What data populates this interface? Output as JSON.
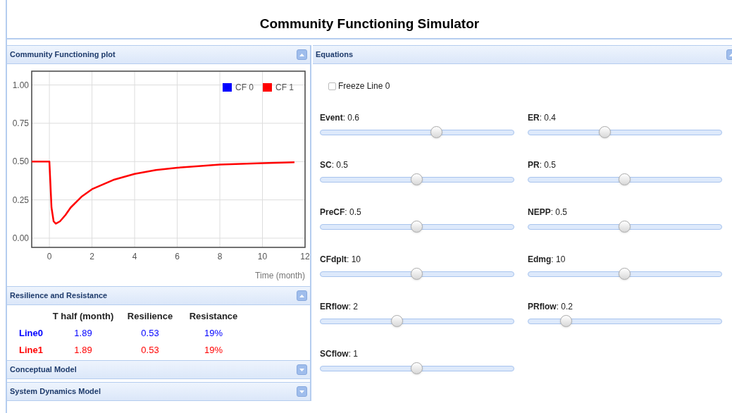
{
  "title": "Community Functioning Simulator",
  "plot_panel": {
    "header": "Community Functioning plot",
    "expanded": true,
    "chart_data": {
      "type": "line",
      "grid": true,
      "legend": true,
      "xlabel": "Time (month)",
      "xlim": [
        -0.83,
        12
      ],
      "ylim": [
        -0.06,
        1.09
      ],
      "xticks": [
        0,
        2,
        4,
        6,
        8,
        10,
        12
      ],
      "yticks": [
        {
          "value": 0,
          "label": "0.00"
        },
        {
          "value": 0.25,
          "label": "0.25"
        },
        {
          "value": 0.5,
          "label": "0.50"
        },
        {
          "value": 0.75,
          "label": "0.75"
        },
        {
          "value": 1,
          "label": "1.00"
        }
      ],
      "x": [
        -0.83,
        0,
        0.1,
        0.2,
        0.3,
        0.5,
        0.75,
        1,
        1.5,
        2,
        3,
        4,
        5,
        6,
        7,
        8,
        10,
        11.5
      ],
      "series": [
        {
          "name": "CF 0",
          "color": "#0000ff",
          "values": [
            null,
            null,
            null,
            null,
            null,
            null,
            null,
            null,
            null,
            null,
            null,
            null,
            null,
            null,
            null,
            null,
            null,
            null
          ]
        },
        {
          "name": "CF 1",
          "color": "#ff0000",
          "values": [
            0.5,
            0.5,
            0.2,
            0.11,
            0.095,
            0.11,
            0.15,
            0.2,
            0.27,
            0.32,
            0.38,
            0.42,
            0.445,
            0.46,
            0.47,
            0.48,
            0.49,
            0.495
          ]
        }
      ]
    }
  },
  "resilience_panel": {
    "header": "Resilience and Resistance",
    "expanded": true,
    "columns": [
      "T half (month)",
      "Resilience",
      "Resistance"
    ],
    "rows": [
      {
        "label": "Line0",
        "color": "#0000ff",
        "cells": [
          "1.89",
          "0.53",
          "19%"
        ]
      },
      {
        "label": "Line1",
        "color": "#ff0000",
        "cells": [
          "1.89",
          "0.53",
          "19%"
        ]
      }
    ]
  },
  "collapsed_panels": [
    {
      "header": "Conceptual Model",
      "expanded": false
    },
    {
      "header": "System Dynamics Model",
      "expanded": false
    }
  ],
  "equations_panel": {
    "header": "Equations",
    "expanded": true,
    "freeze": {
      "label": "Freeze Line 0",
      "checked": false
    },
    "sliders": [
      {
        "label": "**Event**: 0.6",
        "level": 0.6
      },
      {
        "label": "**ER**: 0.4",
        "level": 0.4
      },
      {
        "label": "**SC**: 0.5",
        "level": 0.5
      },
      {
        "label": "**PR**: 0.5",
        "level": 0.5
      },
      {
        "label": "**PreCF**: 0.5",
        "level": 0.5
      },
      {
        "label": "**NEPP**: 0.5",
        "level": 0.5
      },
      {
        "label": "**CFdplt**: 10",
        "level": 0.5
      },
      {
        "label": "**Edmg**: 10",
        "level": 0.5
      },
      {
        "label": "**ERflow**: 2",
        "level": 0.4
      },
      {
        "label": "**PRflow**: 0.2",
        "level": 0.2
      },
      {
        "label": "**SCflow**: 1",
        "level": 0.5
      }
    ]
  }
}
